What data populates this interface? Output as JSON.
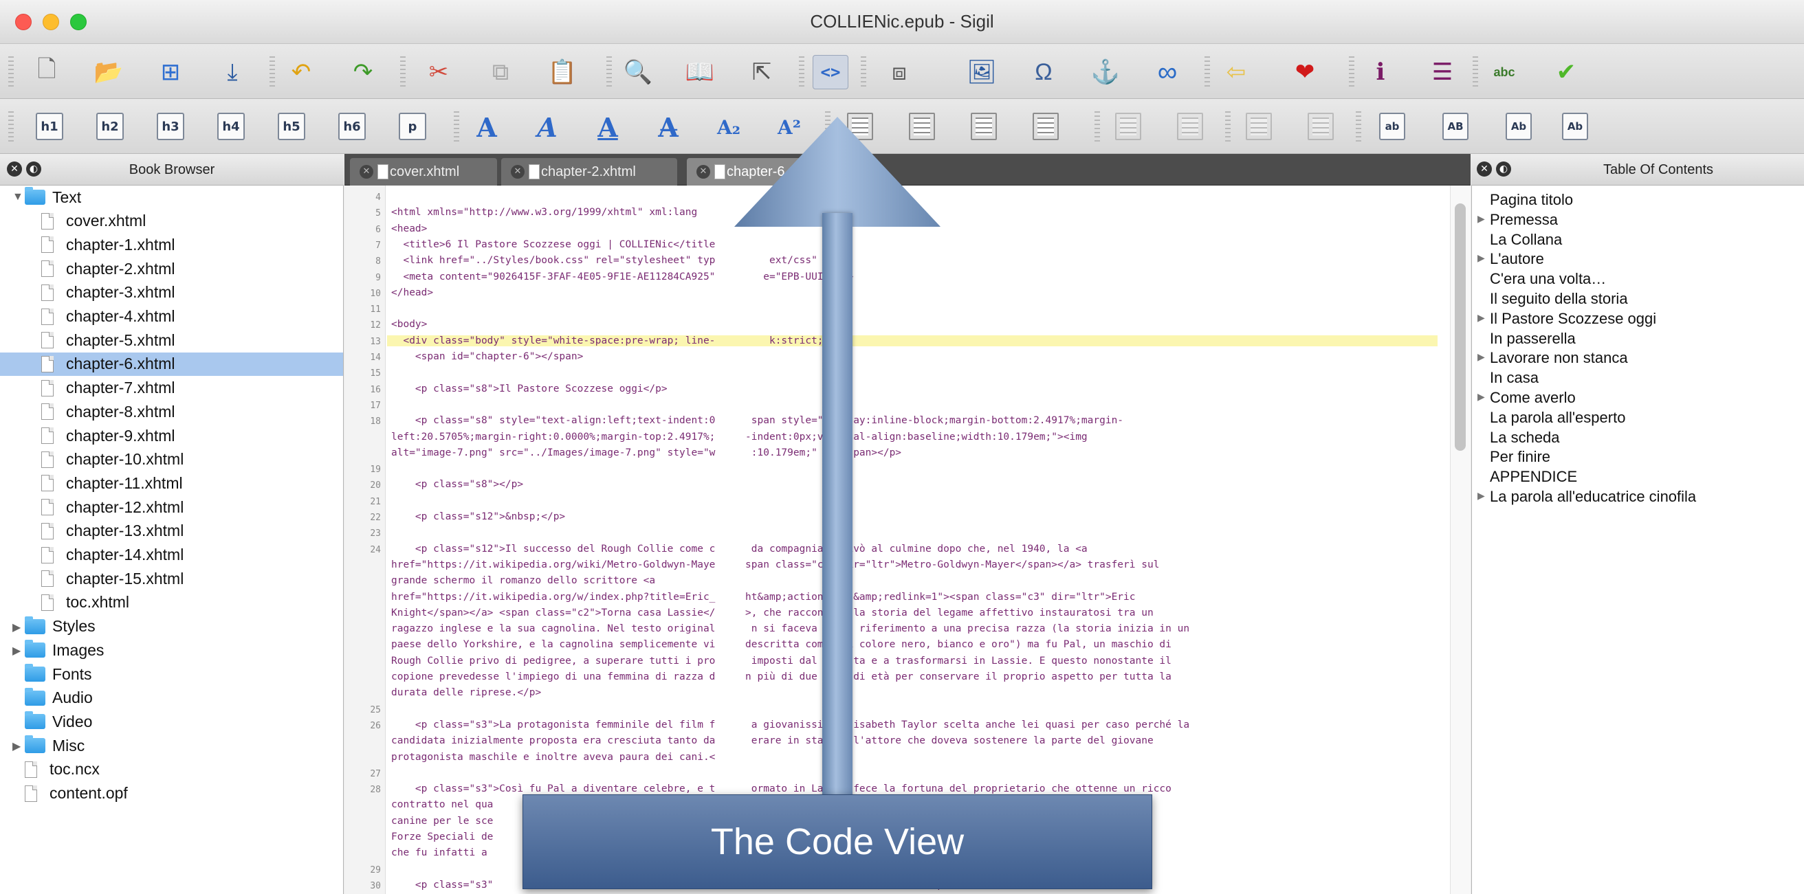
{
  "window": {
    "title": "COLLIENic.epub - Sigil"
  },
  "toolbar_main": [
    {
      "id": "new",
      "glyph": "🗋",
      "color": "#6b6b6b"
    },
    {
      "id": "open",
      "glyph": "📂",
      "color": "#5a7fae"
    },
    {
      "id": "add",
      "glyph": "⊞",
      "color": "#2f6fd1"
    },
    {
      "id": "save",
      "glyph": "⤓",
      "color": "#2a5aa0"
    },
    {
      "id": "undo",
      "glyph": "↶",
      "color": "#e0a312"
    },
    {
      "id": "redo",
      "glyph": "↷",
      "color": "#3d9a28"
    },
    {
      "id": "cut",
      "glyph": "✂",
      "color": "#d14a3c"
    },
    {
      "id": "copy",
      "glyph": "⧉",
      "color": "#aaaaaa"
    },
    {
      "id": "paste",
      "glyph": "📋",
      "color": "#b07a2a"
    },
    {
      "id": "preview",
      "glyph": "🔍",
      "color": "#5a6f8a"
    },
    {
      "id": "book",
      "glyph": "📖",
      "color": "#555555"
    },
    {
      "id": "split",
      "glyph": "⇱",
      "color": "#555555"
    },
    {
      "id": "code",
      "glyph": "<>",
      "color": "#2f69c9"
    },
    {
      "id": "meta",
      "glyph": "⧈",
      "color": "#555555"
    },
    {
      "id": "image",
      "glyph": "🖼",
      "color": "#2a5aa0"
    },
    {
      "id": "special",
      "glyph": "Ω",
      "color": "#3a5f9a"
    },
    {
      "id": "anchor",
      "glyph": "⚓",
      "color": "#2a6bc7"
    },
    {
      "id": "link",
      "glyph": "∞",
      "color": "#2a6bc7"
    },
    {
      "id": "back",
      "glyph": "⇦",
      "color": "#e8c24a"
    },
    {
      "id": "favorite",
      "glyph": "❤",
      "color": "#d11a1a"
    },
    {
      "id": "info",
      "glyph": "ℹ",
      "color": "#7a1b66"
    },
    {
      "id": "list",
      "glyph": "☰",
      "color": "#7a1b66"
    },
    {
      "id": "spell",
      "glyph": "abc",
      "color": "#3a7a2a"
    },
    {
      "id": "validate",
      "glyph": "✔",
      "color": "#4fb82a"
    }
  ],
  "headings": [
    "h1",
    "h2",
    "h3",
    "h4",
    "h5",
    "h6",
    "p"
  ],
  "text_formats": [
    {
      "id": "bold",
      "glyph": "A",
      "style": "bold"
    },
    {
      "id": "italic",
      "glyph": "A",
      "style": "italic"
    },
    {
      "id": "underline",
      "glyph": "A",
      "style": "underline"
    },
    {
      "id": "strike",
      "glyph": "A̶",
      "style": "normal"
    },
    {
      "id": "subscript",
      "glyph": "A₂",
      "style": "normal"
    },
    {
      "id": "superscript",
      "glyph": "A²",
      "style": "normal"
    }
  ],
  "case_buttons": [
    "ab",
    "AB",
    "Ab",
    "Ab"
  ],
  "book_browser": {
    "title": "Book Browser",
    "items": [
      {
        "label": "Text",
        "type": "folder",
        "level": 0,
        "expanded": true
      },
      {
        "label": "cover.xhtml",
        "type": "file",
        "level": 1
      },
      {
        "label": "chapter-1.xhtml",
        "type": "file",
        "level": 1
      },
      {
        "label": "chapter-2.xhtml",
        "type": "file",
        "level": 1
      },
      {
        "label": "chapter-3.xhtml",
        "type": "file",
        "level": 1
      },
      {
        "label": "chapter-4.xhtml",
        "type": "file",
        "level": 1
      },
      {
        "label": "chapter-5.xhtml",
        "type": "file",
        "level": 1
      },
      {
        "label": "chapter-6.xhtml",
        "type": "file",
        "level": 1,
        "selected": true
      },
      {
        "label": "chapter-7.xhtml",
        "type": "file",
        "level": 1
      },
      {
        "label": "chapter-8.xhtml",
        "type": "file",
        "level": 1
      },
      {
        "label": "chapter-9.xhtml",
        "type": "file",
        "level": 1
      },
      {
        "label": "chapter-10.xhtml",
        "type": "file",
        "level": 1
      },
      {
        "label": "chapter-11.xhtml",
        "type": "file",
        "level": 1
      },
      {
        "label": "chapter-12.xhtml",
        "type": "file",
        "level": 1
      },
      {
        "label": "chapter-13.xhtml",
        "type": "file",
        "level": 1
      },
      {
        "label": "chapter-14.xhtml",
        "type": "file",
        "level": 1
      },
      {
        "label": "chapter-15.xhtml",
        "type": "file",
        "level": 1
      },
      {
        "label": "toc.xhtml",
        "type": "file",
        "level": 1
      },
      {
        "label": "Styles",
        "type": "folder",
        "level": 0,
        "collapsed": true
      },
      {
        "label": "Images",
        "type": "folder",
        "level": 0,
        "collapsed": true
      },
      {
        "label": "Fonts",
        "type": "folder",
        "level": 0
      },
      {
        "label": "Audio",
        "type": "folder",
        "level": 0
      },
      {
        "label": "Video",
        "type": "folder",
        "level": 0
      },
      {
        "label": "Misc",
        "type": "folder",
        "level": 0,
        "collapsed": true
      },
      {
        "label": "toc.ncx",
        "type": "file",
        "level": 0
      },
      {
        "label": "content.opf",
        "type": "file",
        "level": 0
      }
    ]
  },
  "tabs": [
    {
      "label": "cover.xhtml",
      "active": false
    },
    {
      "label": "chapter-2.xhtml",
      "active": false
    },
    {
      "label": "chapter-6.x",
      "active": true
    }
  ],
  "code_lines": [
    {
      "n": "4",
      "text": ""
    },
    {
      "n": "5",
      "text": "<html xmlns=\"http://www.w3.org/1999/xhtml\" xml:lang"
    },
    {
      "n": "6",
      "text": "<head>"
    },
    {
      "n": "7",
      "text": "  <title>6 Il Pastore Scozzese oggi | COLLIENic</title"
    },
    {
      "n": "8",
      "text": "  <link href=\"../Styles/book.css\" rel=\"stylesheet\" typ         ext/css\" />"
    },
    {
      "n": "9",
      "text": "  <meta content=\"9026415F-3FAF-4E05-9F1E-AE11284CA925\"        e=\"EPB-UUID\" />"
    },
    {
      "n": "10",
      "text": "</head>"
    },
    {
      "n": "11",
      "text": ""
    },
    {
      "n": "12",
      "text": "<body>"
    },
    {
      "n": "13",
      "text": "  <div class=\"body\" style=\"white-space:pre-wrap; line-         k:strict;\">",
      "hl": true
    },
    {
      "n": "14",
      "text": "    <span id=\"chapter-6\"></span>"
    },
    {
      "n": "15",
      "text": ""
    },
    {
      "n": "16",
      "text": "    <p class=\"s8\">Il Pastore Scozzese oggi</p>"
    },
    {
      "n": "17",
      "text": ""
    },
    {
      "n": "18",
      "text": "    <p class=\"s8\" style=\"text-align:left;text-indent:0      span style=\"display:inline-block;margin-bottom:2.4917%;margin-"
    },
    {
      "n": "",
      "text": "left:20.5705%;margin-right:0.0000%;margin-top:2.4917%;     -indent:0px;vertical-align:baseline;width:10.179em;\"><img"
    },
    {
      "n": "",
      "text": "alt=\"image-7.png\" src=\"../Images/image-7.png\" style=\"w      :10.179em;\" /></span></p>"
    },
    {
      "n": "19",
      "text": ""
    },
    {
      "n": "20",
      "text": "    <p class=\"s8\"></p>"
    },
    {
      "n": "21",
      "text": ""
    },
    {
      "n": "22",
      "text": "    <p class=\"s12\">&nbsp;</p>"
    },
    {
      "n": "23",
      "text": ""
    },
    {
      "n": "24",
      "text": "    <p class=\"s12\">Il successo del Rough Collie come c      da compagnia arrivò al culmine dopo che, nel 1940, la <a"
    },
    {
      "n": "",
      "text": "href=\"https://it.wikipedia.org/wiki/Metro-Goldwyn-Maye     span class=\"c3\" dir=\"ltr\">Metro-Goldwyn-Mayer</span></a> trasferì sul"
    },
    {
      "n": "",
      "text": "grande schermo il romanzo dello scrittore <a"
    },
    {
      "n": "",
      "text": "href=\"https://it.wikipedia.org/w/index.php?title=Eric_     ht&amp;action=edit&amp;redlink=1\"><span class=\"c3\" dir=\"ltr\">Eric"
    },
    {
      "n": "",
      "text": "Knight</span></a> <span class=\"c2\">Torna casa Lassie</     >, che raccontava la storia del legame affettivo instauratosi tra un"
    },
    {
      "n": "",
      "text": "ragazzo inglese e la sua cagnolina. Nel testo original      n si faceva alcun riferimento a una precisa razza (la storia inizia in un"
    },
    {
      "n": "",
      "text": "paese dello Yorkshire, e la cagnolina semplicemente vi     descritta come \"di colore nero, bianco e oro\") ma fu Pal, un maschio di"
    },
    {
      "n": "",
      "text": "Rough Collie privo di pedigree, a superare tutti i pro      imposti dal regista e a trasformarsi in Lassie. E questo nonostante il"
    },
    {
      "n": "",
      "text": "copione prevedesse l'impiego di una femmina di razza d     n più di due anni di età per conservare il proprio aspetto per tutta la"
    },
    {
      "n": "",
      "text": "durata delle riprese.</p>"
    },
    {
      "n": "25",
      "text": ""
    },
    {
      "n": "26",
      "text": "    <p class=\"s3\">La protagonista femminile del film f      a giovanissima Elisabeth Taylor scelta anche lei quasi per caso perché la"
    },
    {
      "n": "",
      "text": "candidata inizialmente proposta era cresciuta tanto da      erare in statura l'attore che doveva sostenere la parte del giovane"
    },
    {
      "n": "",
      "text": "protagonista maschile e inoltre aveva paura dei cani.<"
    },
    {
      "n": "27",
      "text": ""
    },
    {
      "n": "28",
      "text": "    <p class=\"s3\">Così fu Pal a diventare celebre, e t      ormato in Lassie fece la fortuna del proprietario che ottenne un ricco"
    },
    {
      "n": "",
      "text": "contratto nel qua                                                              usivo e l'impiego di controfigure"
    },
    {
      "n": "",
      "text": "canine per le sce                                                              entato nel frattempo maggiore delle"
    },
    {
      "n": "",
      "text": "Forze Speciali de                                                               terminassero le riprese del film"
    },
    {
      "n": "",
      "text": "che fu infatti a"
    },
    {
      "n": "29",
      "text": ""
    },
    {
      "n": "30",
      "text": "    <p class=\"s3\"                                                              uaranta MGM produsse altri sei film"
    }
  ],
  "toc": {
    "title": "Table Of Contents",
    "items": [
      {
        "label": "Pagina titolo",
        "arrow": false
      },
      {
        "label": "Premessa",
        "arrow": true
      },
      {
        "label": "La Collana",
        "arrow": false
      },
      {
        "label": "L'autore",
        "arrow": true
      },
      {
        "label": "C'era una volta…",
        "arrow": false
      },
      {
        "label": "Il seguito della storia",
        "arrow": false
      },
      {
        "label": "Il Pastore Scozzese oggi",
        "arrow": true
      },
      {
        "label": "In passerella",
        "arrow": false
      },
      {
        "label": "Lavorare non stanca",
        "arrow": true
      },
      {
        "label": "In casa",
        "arrow": false
      },
      {
        "label": "Come averlo",
        "arrow": true
      },
      {
        "label": "La parola all'esperto",
        "arrow": false
      },
      {
        "label": "La scheda",
        "arrow": false
      },
      {
        "label": "Per finire",
        "arrow": false
      },
      {
        "label": "APPENDICE",
        "arrow": false
      },
      {
        "label": "La parola all'educatrice cinofila",
        "arrow": true
      }
    ]
  },
  "callout": {
    "label": "The Code View"
  }
}
